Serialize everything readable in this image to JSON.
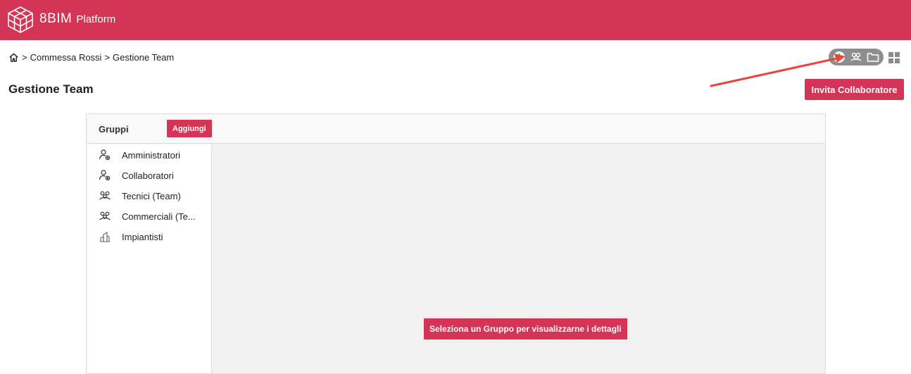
{
  "header": {
    "brand_main": "8BIM",
    "brand_sub": "Platform",
    "background_color": "#d43455"
  },
  "breadcrumb": {
    "home_icon": "home-icon",
    "items": [
      "Commessa Rossi",
      "Gestione Team"
    ],
    "separator": ">"
  },
  "page": {
    "title": "Gestione Team",
    "invite_button": "Invita Collaboratore"
  },
  "view_switcher": {
    "icons": [
      "info-icon",
      "team-icon",
      "folder-icon"
    ],
    "grid_icon": "grid-icon"
  },
  "groups_panel": {
    "header_label": "Gruppi",
    "add_button": "Aggiungi",
    "items": [
      {
        "label": "Amministratori",
        "icon": "user-gear-icon"
      },
      {
        "label": "Collaboratori",
        "icon": "user-gear-icon"
      },
      {
        "label": "Tecnici (Team)",
        "icon": "team-icon"
      },
      {
        "label": "Commerciali (Te...",
        "icon": "team-icon"
      },
      {
        "label": "Impiantisti",
        "icon": "building-icon"
      }
    ],
    "empty_message": "Seleziona un Gruppo per visualizzarne i dettagli"
  },
  "colors": {
    "accent": "#d43455",
    "annotation_arrow": "#e8453c"
  }
}
